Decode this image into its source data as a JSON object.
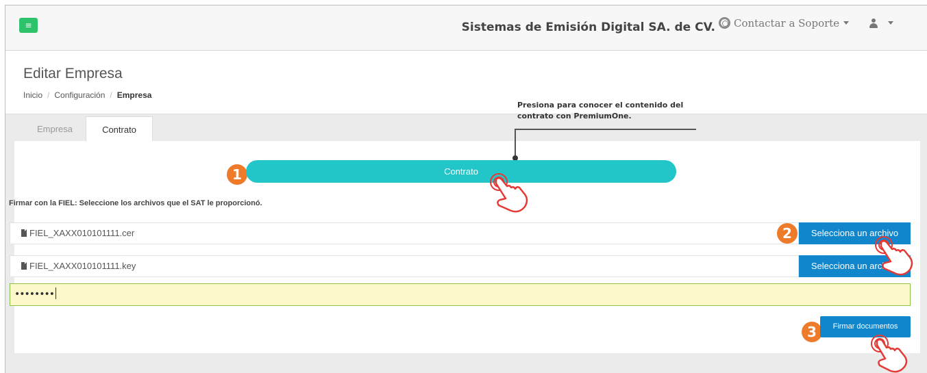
{
  "navbar": {
    "menu_icon": "hamburger-icon",
    "company_name": "Sistemas de Emisión Digital SA. de CV.",
    "support_label": "Contactar a Soporte",
    "support_icon": "lifebuoy-icon",
    "user_icon": "user-icon"
  },
  "page": {
    "title": "Editar Empresa",
    "breadcrumb": [
      "Inicio",
      "Configuración",
      "Empresa"
    ]
  },
  "tabs": [
    {
      "label": "Empresa",
      "active": false
    },
    {
      "label": "Contrato",
      "active": true
    }
  ],
  "annotation": {
    "line1": "Presiona para conocer el contenido del",
    "line2": "contrato con PremiumOne."
  },
  "contrato_button": "Contrato",
  "steps": [
    "1",
    "2",
    "3"
  ],
  "fiel": {
    "instruction": "Firmar con la FIEL: Seleccione los archivos que el SAT le proporcionó.",
    "files": [
      {
        "name": "FIEL_XAXX010101111.cer",
        "button": "Selecciona un archivo"
      },
      {
        "name": "FIEL_XAXX010101111.key",
        "button": "Selecciona un archivo"
      }
    ],
    "password_mask": "••••••••"
  },
  "sign_button": "Firmar documentos",
  "colors": {
    "menu_green": "#2cc36b",
    "contrato_teal": "#22c6c9",
    "primary_blue": "#1286cc",
    "step_orange": "#ee7b2a",
    "password_bg": "#fcf8c9",
    "password_border": "#8bc34a"
  }
}
